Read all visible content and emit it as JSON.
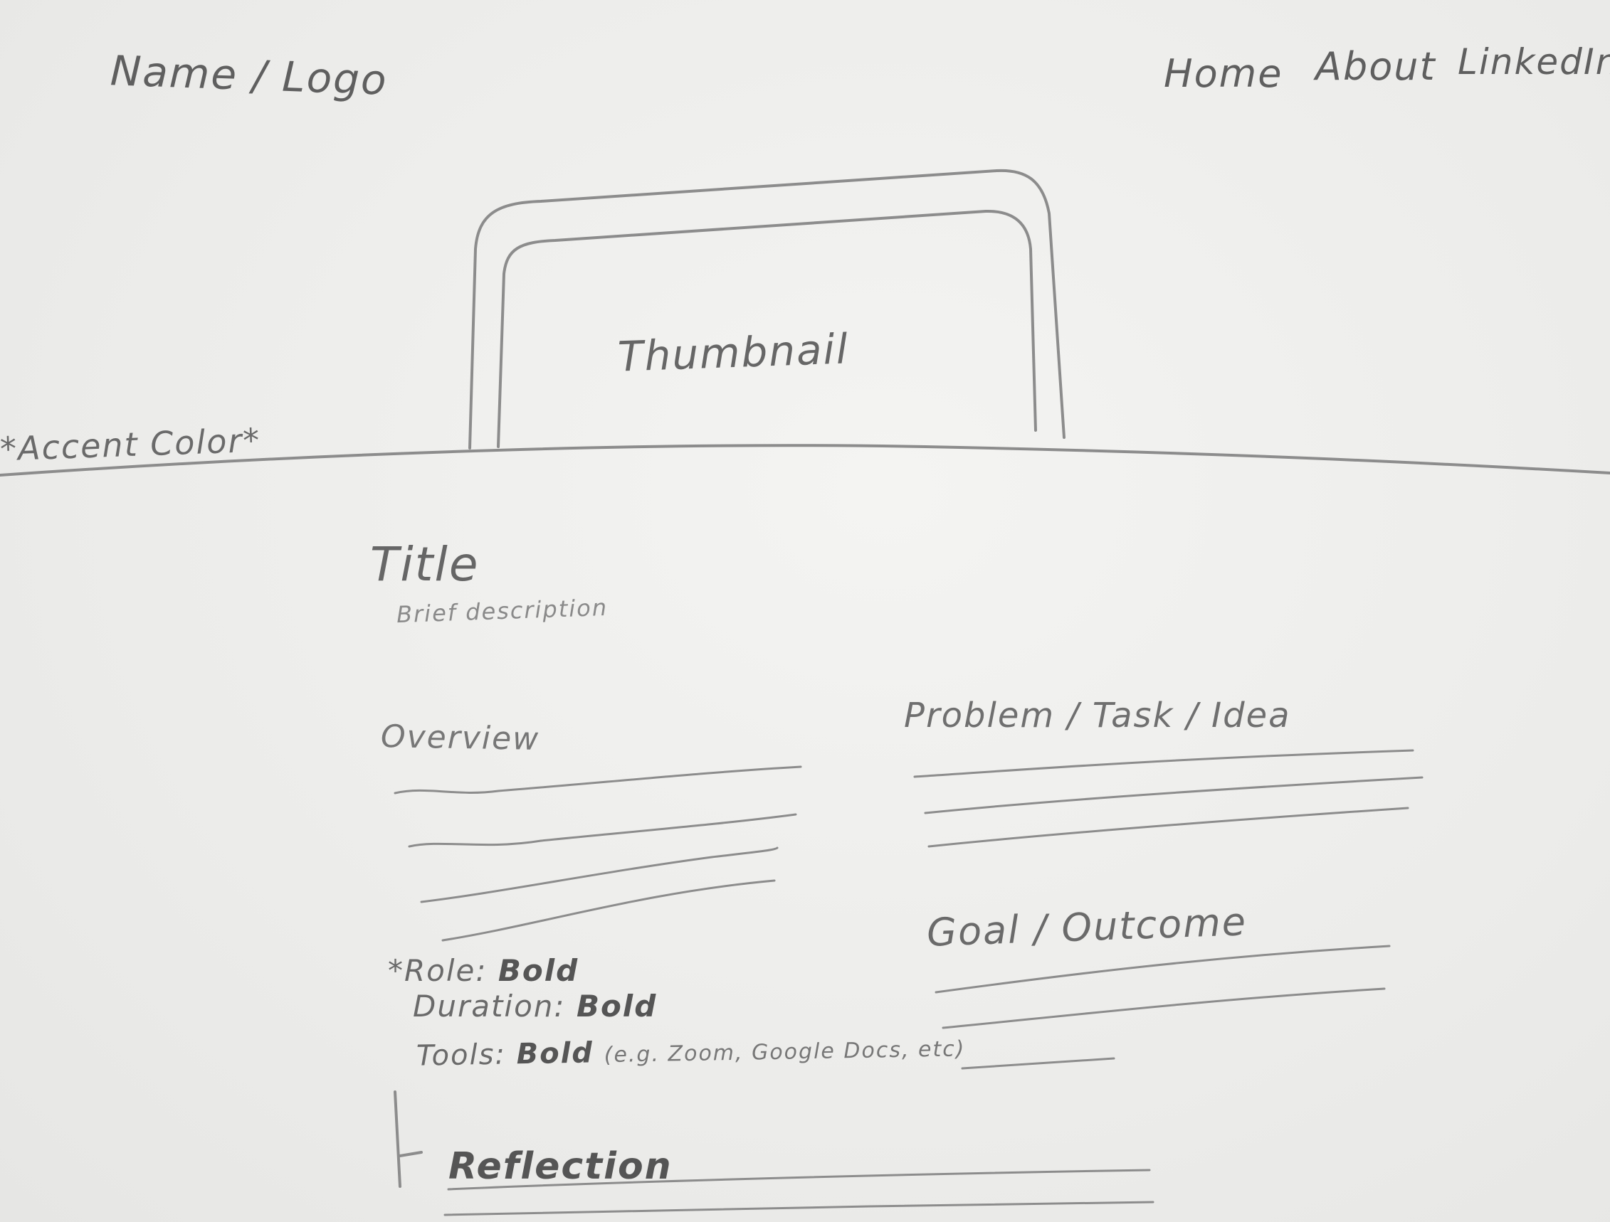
{
  "header": {
    "logo": "Name / Logo",
    "nav": {
      "home": "Home",
      "about": "About",
      "linkedin": "LinkedIn"
    }
  },
  "hero": {
    "accent_note": "*Accent Color*",
    "thumbnail_label": "Thumbnail"
  },
  "project": {
    "title": "Title",
    "brief": "Brief description",
    "overview_heading": "Overview",
    "problem_heading": "Problem / Task / Idea",
    "goal_heading": "Goal / Outcome",
    "details": {
      "role_label": "*Role:",
      "role_value": "Bold",
      "duration_label": "Duration:",
      "duration_value": "Bold",
      "tools_label": "Tools:",
      "tools_value": "Bold",
      "tools_examples": "(e.g. Zoom, Google Docs, etc)"
    },
    "reflection_heading": "Reflection"
  },
  "colors": {
    "pencil": "#8a8a8a",
    "paper": "#ececeb"
  }
}
